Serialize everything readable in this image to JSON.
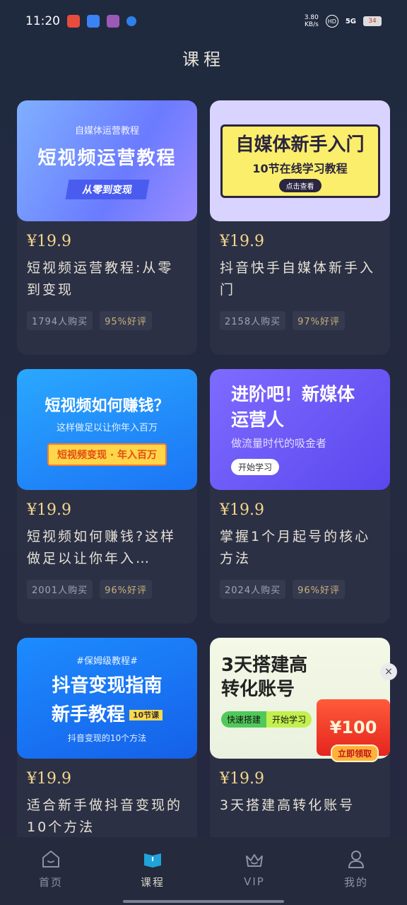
{
  "status_bar": {
    "time": "11:20",
    "net_speed_value": "3.80",
    "net_speed_unit": "KB/s",
    "hd_badge": "HD",
    "network": "5G",
    "battery": "34"
  },
  "page": {
    "title": "课程"
  },
  "courses": [
    {
      "thumb": {
        "subtitle": "自媒体运营教程",
        "main": "短视频运营教程",
        "pill": "从零到变现"
      },
      "price": "¥19.9",
      "title": "短视频运营教程:从零到变现",
      "purchases": "1794人购买",
      "rating": "95%好评"
    },
    {
      "thumb": {
        "main": "自媒体新手入门",
        "subtitle": "10节在线学习教程",
        "button": "点击查看"
      },
      "price": "¥19.9",
      "title": "抖音快手自媒体新手入门",
      "purchases": "2158人购买",
      "rating": "97%好评"
    },
    {
      "thumb": {
        "main": "短视频如何赚钱？",
        "subtitle": "这样做足以让你年入百万",
        "pill": "短视频变现 · 年入百万"
      },
      "price": "¥19.9",
      "title": "短视频如何赚钱?这样做足以让你年入…",
      "purchases": "2001人购买",
      "rating": "96%好评"
    },
    {
      "thumb": {
        "main": "进阶吧！新媒体运营人",
        "subtitle": "做流量时代的吸金者",
        "button": "开始学习"
      },
      "price": "¥19.9",
      "title": "掌握1个月起号的核心方法",
      "purchases": "2024人购买",
      "rating": "96%好评"
    },
    {
      "thumb": {
        "subtitle": "#保姆级教程#",
        "main": "抖音变现指南",
        "main2": "新手教程",
        "lessons": "10节课",
        "footer": "抖音变现的10个方法"
      },
      "price": "¥19.9",
      "title": "适合新手做抖音变现的10个方法",
      "purchases": "",
      "rating": ""
    },
    {
      "thumb": {
        "main": "3天搭建高转化账号",
        "button1": "快速搭建",
        "button2": "开始学习"
      },
      "price": "¥19.9",
      "title": "3天搭建高转化账号",
      "purchases": "",
      "rating": ""
    }
  ],
  "coupon": {
    "amount": "¥100",
    "claim": "立即领取",
    "close": "×"
  },
  "tabbar": [
    {
      "label": "首页",
      "icon": "home-icon"
    },
    {
      "label": "课程",
      "icon": "book-icon"
    },
    {
      "label": "VIP",
      "icon": "crown-icon"
    },
    {
      "label": "我的",
      "icon": "user-icon"
    }
  ],
  "colors": {
    "accent": "#f2d58a",
    "background": "#232a40",
    "card": "#2b3045"
  }
}
